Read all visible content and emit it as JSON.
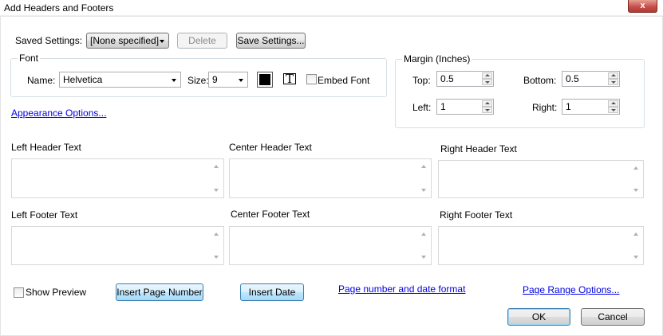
{
  "window": {
    "title": "Add Headers and Footers",
    "close_glyph": "x"
  },
  "saved_settings": {
    "label": "Saved Settings:",
    "selected": "[None specified]",
    "delete_label": "Delete",
    "save_label": "Save Settings..."
  },
  "font": {
    "group_label": "Font",
    "name_label": "Name:",
    "name_value": "Helvetica",
    "size_label": "Size:",
    "size_value": "9",
    "color": "#000000",
    "embed_label": "Embed Font"
  },
  "margin": {
    "group_label": "Margin (Inches)",
    "top_label": "Top:",
    "top_value": "0.5",
    "bottom_label": "Bottom:",
    "bottom_value": "0.5",
    "left_label": "Left:",
    "left_value": "1",
    "right_label": "Right:",
    "right_value": "1"
  },
  "appearance_link": "Appearance Options...",
  "headers": {
    "left_label": "Left Header Text",
    "center_label": "Center Header Text",
    "right_label": "Right Header Text"
  },
  "footers": {
    "left_label": "Left Footer Text",
    "center_label": "Center Footer Text",
    "right_label": "Right Footer Text"
  },
  "bottom": {
    "show_preview_label": "Show Preview",
    "insert_page_number_label": "Insert Page Number",
    "insert_date_label": "Insert Date",
    "page_date_format_link": "Page number and date format",
    "page_range_link": "Page Range Options...",
    "ok_label": "OK",
    "cancel_label": "Cancel"
  }
}
